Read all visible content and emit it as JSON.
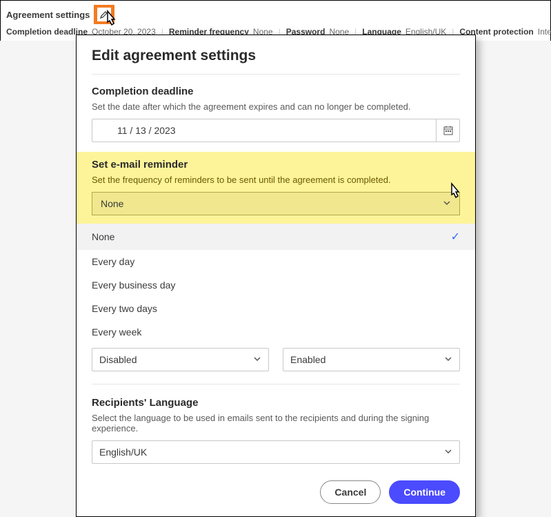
{
  "header": {
    "title": "Agreement settings",
    "deadline": {
      "label": "Completion deadline",
      "value": "October 20, 2023"
    },
    "reminder": {
      "label": "Reminder frequency",
      "value": "None"
    },
    "password": {
      "label": "Password",
      "value": "None"
    },
    "language": {
      "label": "Language",
      "value": "English/UK"
    },
    "protection": {
      "label": "Content protection",
      "value": "Internal disabled & External enabled"
    }
  },
  "modal": {
    "title": "Edit agreement settings",
    "deadline": {
      "title": "Completion deadline",
      "desc": "Set the date after which the agreement expires and can no longer be completed.",
      "value": "11 / 13 / 2023"
    },
    "reminder": {
      "title": "Set e-mail reminder",
      "desc": "Set the frequency of reminders to be sent until the agreement is completed.",
      "selected": "None",
      "options": [
        "None",
        "Every day",
        "Every business day",
        "Every two days",
        "Every week"
      ]
    },
    "internal_select": "Disabled",
    "external_select": "Enabled",
    "language": {
      "title": "Recipients' Language",
      "desc": "Select the language to be used in emails sent to the recipients and during the signing experience.",
      "value": "English/UK"
    },
    "buttons": {
      "cancel": "Cancel",
      "continue": "Continue"
    }
  }
}
